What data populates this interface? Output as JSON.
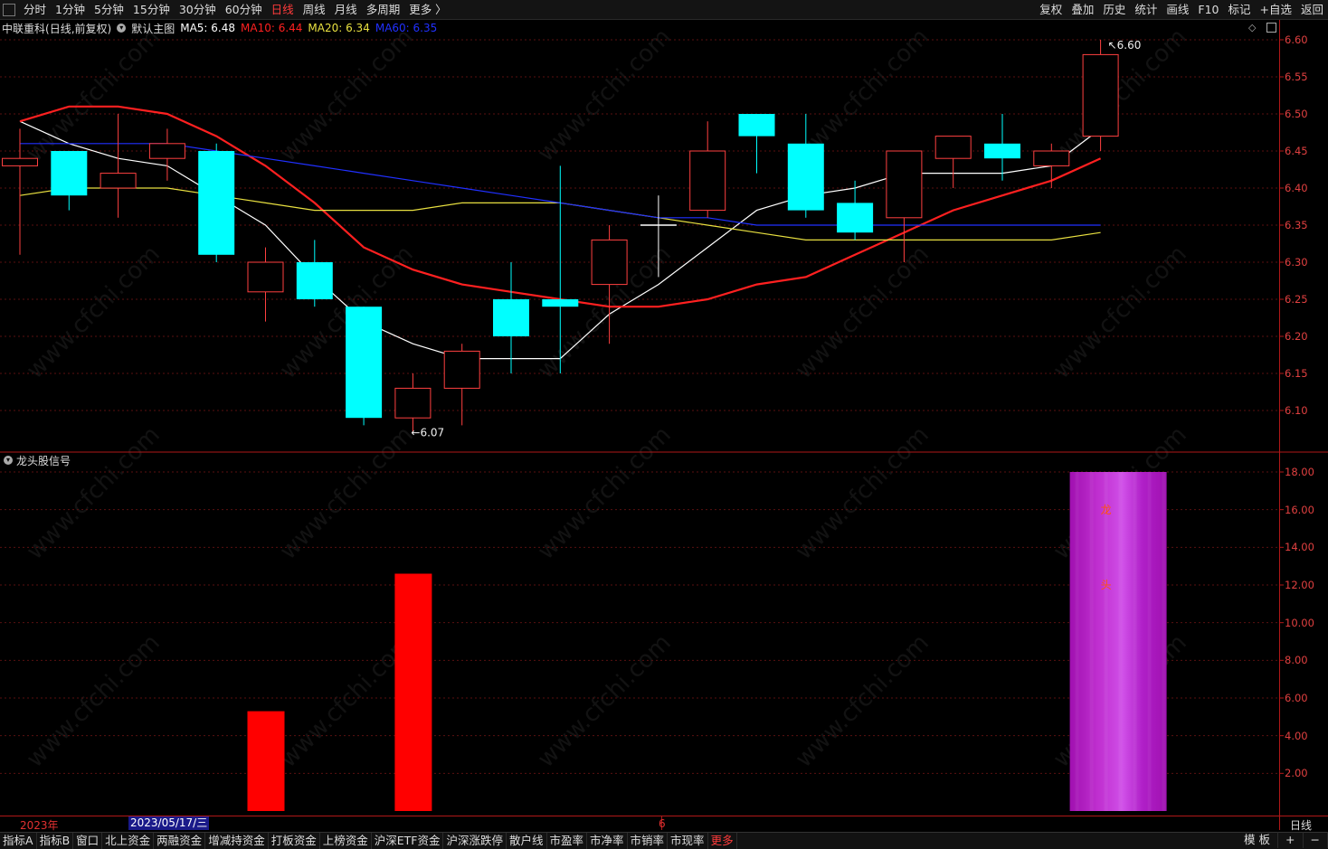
{
  "toolbar": {
    "periods": [
      "分时",
      "1分钟",
      "5分钟",
      "15分钟",
      "30分钟",
      "60分钟",
      "日线",
      "周线",
      "月线",
      "多周期",
      "更多 〉"
    ],
    "active_period": "日线",
    "actions": [
      "复权",
      "叠加",
      "历史",
      "统计",
      "画线",
      "F10",
      "标记",
      "+自选",
      "返回"
    ]
  },
  "main_chart": {
    "stock_name": "中联重科",
    "period_note": "(日线,前复权)",
    "template_name": "默认主图",
    "ma_legend": [
      {
        "label": "MA5: 6.48",
        "color": "#ffffff"
      },
      {
        "label": "MA10: 6.44",
        "color": "#ff2020"
      },
      {
        "label": "MA20: 6.34",
        "color": "#e8e040"
      },
      {
        "label": "MA60: 6.35",
        "color": "#2030ff"
      }
    ],
    "high_marker": "6.60",
    "low_marker": "6.07",
    "y_ticks": [
      "6.60",
      "6.55",
      "6.50",
      "6.45",
      "6.40",
      "6.35",
      "6.30",
      "6.25",
      "6.20",
      "6.15",
      "6.10"
    ]
  },
  "indicator_chart": {
    "name": "龙头股信号",
    "y_ticks": [
      "18.00",
      "16.00",
      "14.00",
      "12.00",
      "10.00",
      "8.00",
      "6.00",
      "4.00",
      "2.00"
    ],
    "signal_chars": [
      "龙",
      "头"
    ],
    "colors": {
      "bar": "#ff0000",
      "signal": "#b020c0"
    }
  },
  "timeline": {
    "year_label": "2023年",
    "cursor_date": "2023/05/17/三",
    "month_label": "6",
    "period_label": "日线"
  },
  "bottom_tabs": [
    "指标A",
    "指标B",
    "窗口",
    "北上资金",
    "两融资金",
    "增减持资金",
    "打板资金",
    "上榜资金",
    "沪深ETF资金",
    "沪深涨跌停",
    "散户线",
    "市盈率",
    "市净率",
    "市销率",
    "市现率",
    "更多"
  ],
  "active_bottom_tab": "更多",
  "bottom_right": [
    "模 板",
    "+",
    "−"
  ],
  "chart_data": [
    {
      "type": "candlestick",
      "title": "中联重科 (日线,前复权)",
      "ylim": [
        6.05,
        6.62
      ],
      "candles": [
        {
          "o": 6.43,
          "c": 6.44,
          "h": 6.48,
          "l": 6.31
        },
        {
          "o": 6.45,
          "c": 6.39,
          "h": 6.45,
          "l": 6.37
        },
        {
          "o": 6.4,
          "c": 6.42,
          "h": 6.5,
          "l": 6.36
        },
        {
          "o": 6.44,
          "c": 6.46,
          "h": 6.48,
          "l": 6.41
        },
        {
          "o": 6.45,
          "c": 6.31,
          "h": 6.46,
          "l": 6.3
        },
        {
          "o": 6.26,
          "c": 6.3,
          "h": 6.32,
          "l": 6.22
        },
        {
          "o": 6.3,
          "c": 6.25,
          "h": 6.33,
          "l": 6.24
        },
        {
          "o": 6.24,
          "c": 6.09,
          "h": 6.24,
          "l": 6.08
        },
        {
          "o": 6.09,
          "c": 6.13,
          "h": 6.15,
          "l": 6.07
        },
        {
          "o": 6.13,
          "c": 6.18,
          "h": 6.19,
          "l": 6.08
        },
        {
          "o": 6.25,
          "c": 6.2,
          "h": 6.3,
          "l": 6.15
        },
        {
          "o": 6.25,
          "c": 6.24,
          "h": 6.43,
          "l": 6.15
        },
        {
          "o": 6.27,
          "c": 6.33,
          "h": 6.35,
          "l": 6.19
        },
        {
          "o": 6.35,
          "c": 6.35,
          "h": 6.39,
          "l": 6.28
        },
        {
          "o": 6.37,
          "c": 6.45,
          "h": 6.49,
          "l": 6.36
        },
        {
          "o": 6.5,
          "c": 6.47,
          "h": 6.5,
          "l": 6.42
        },
        {
          "o": 6.46,
          "c": 6.37,
          "h": 6.5,
          "l": 6.36
        },
        {
          "o": 6.38,
          "c": 6.34,
          "h": 6.41,
          "l": 6.33
        },
        {
          "o": 6.36,
          "c": 6.45,
          "h": 6.45,
          "l": 6.3
        },
        {
          "o": 6.44,
          "c": 6.47,
          "h": 6.47,
          "l": 6.4
        },
        {
          "o": 6.46,
          "c": 6.44,
          "h": 6.5,
          "l": 6.41
        },
        {
          "o": 6.43,
          "c": 6.45,
          "h": 6.46,
          "l": 6.4
        },
        {
          "o": 6.47,
          "c": 6.58,
          "h": 6.6,
          "l": 6.45
        }
      ],
      "ma": [
        {
          "name": "MA5",
          "color": "#ffffff",
          "values": [
            6.49,
            6.46,
            6.44,
            6.43,
            6.39,
            6.35,
            6.28,
            6.22,
            6.19,
            6.17,
            6.17,
            6.17,
            6.23,
            6.27,
            6.32,
            6.37,
            6.39,
            6.4,
            6.42,
            6.42,
            6.42,
            6.43,
            6.48
          ]
        },
        {
          "name": "MA10",
          "color": "#ff2020",
          "values": [
            6.49,
            6.51,
            6.51,
            6.5,
            6.47,
            6.43,
            6.38,
            6.32,
            6.29,
            6.27,
            6.26,
            6.25,
            6.24,
            6.24,
            6.25,
            6.27,
            6.28,
            6.31,
            6.34,
            6.37,
            6.39,
            6.41,
            6.44
          ]
        },
        {
          "name": "MA20",
          "color": "#e8e040",
          "values": [
            6.39,
            6.4,
            6.4,
            6.4,
            6.39,
            6.38,
            6.37,
            6.37,
            6.37,
            6.38,
            6.38,
            6.38,
            6.37,
            6.36,
            6.35,
            6.34,
            6.33,
            6.33,
            6.33,
            6.33,
            6.33,
            6.33,
            6.34
          ]
        },
        {
          "name": "MA60",
          "color": "#2030ff",
          "values": [
            6.46,
            6.46,
            6.46,
            6.46,
            6.45,
            6.44,
            6.43,
            6.42,
            6.41,
            6.4,
            6.39,
            6.38,
            6.37,
            6.36,
            6.36,
            6.35,
            6.35,
            6.35,
            6.35,
            6.35,
            6.35,
            6.35,
            6.35
          ]
        }
      ]
    },
    {
      "type": "bar",
      "title": "龙头股信号",
      "ylim": [
        0,
        19
      ],
      "values": [
        0,
        0,
        0,
        0,
        0,
        5.3,
        0,
        0,
        12.6,
        0,
        0,
        0,
        0,
        0,
        0,
        0,
        0,
        0,
        0,
        0,
        0,
        0,
        0
      ],
      "signal_index": 22,
      "signal_value": 18.0
    }
  ]
}
